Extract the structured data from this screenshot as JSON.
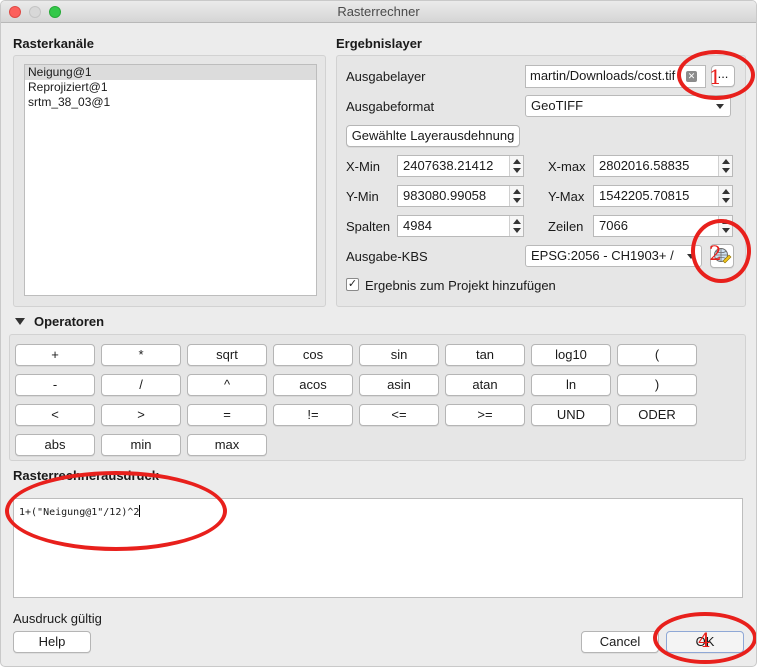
{
  "window": {
    "title": "Rasterrechner"
  },
  "raster_bands": {
    "heading": "Rasterkanäle",
    "items": [
      "Neigung@1",
      "Reprojiziert@1",
      "srtm_38_03@1"
    ]
  },
  "result_layer": {
    "heading": "Ergebnislayer",
    "output_layer_label": "Ausgabelayer",
    "output_layer_value": "martin/Downloads/cost.tif",
    "browse_label": "...",
    "output_format_label": "Ausgabeformat",
    "output_format_value": "GeoTIFF",
    "selected_extent_label": "Gewählte Layerausdehnung",
    "xmin_label": "X-Min",
    "xmin_value": "2407638.21412",
    "xmax_label": "X-max",
    "xmax_value": "2802016.58835",
    "ymin_label": "Y-Min",
    "ymin_value": "983080.99058",
    "ymax_label": "Y-Max",
    "ymax_value": "1542205.70815",
    "columns_label": "Spalten",
    "columns_value": "4984",
    "rows_label": "Zeilen",
    "rows_value": "7066",
    "crs_label": "Ausgabe-KBS",
    "crs_value": "EPSG:2056 - CH1903+ /",
    "add_to_project_label": "Ergebnis zum Projekt hinzufügen",
    "add_to_project_checked": true
  },
  "operators": {
    "heading": "Operatoren",
    "row1": [
      "+",
      "*",
      "sqrt",
      "cos",
      "sin",
      "tan",
      "log10",
      "("
    ],
    "row2": [
      "-",
      "/",
      "^",
      "acos",
      "asin",
      "atan",
      "ln",
      ")"
    ],
    "row3": [
      "<",
      ">",
      "=",
      "!=",
      "<=",
      ">=",
      "UND",
      "ODER"
    ],
    "row4": [
      "abs",
      "min",
      "max"
    ]
  },
  "expression": {
    "heading": "Rasterrechnerausdruck",
    "value": "1+(\"Neigung@1\"/12)^2",
    "status": "Ausdruck gültig"
  },
  "footer": {
    "help_label": "Help",
    "cancel_label": "Cancel",
    "ok_label": "OK"
  },
  "annotations": [
    "1",
    "2",
    "4"
  ],
  "colors": {
    "annotation": "#e8201c"
  }
}
